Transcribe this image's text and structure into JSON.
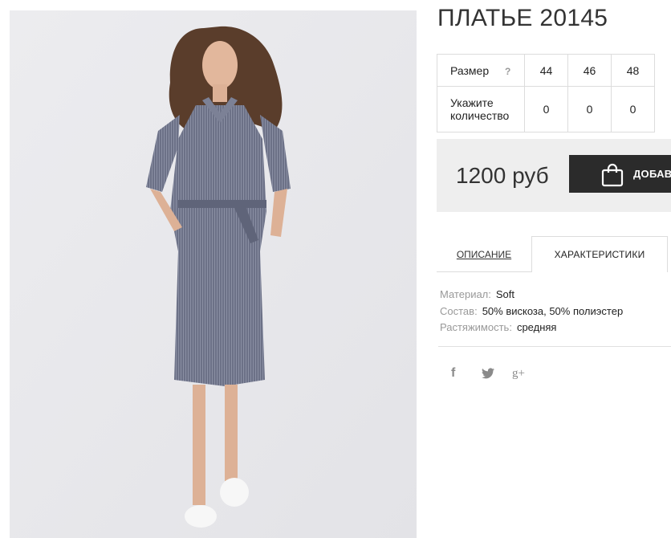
{
  "product": {
    "title": "ПЛАТЬЕ 20145",
    "image_alt": "model-wearing-dress"
  },
  "sizes": {
    "size_label": "Размер",
    "help": "?",
    "quantity_label_line1": "Укажите",
    "quantity_label_line2": "количество",
    "options": [
      {
        "size": "44",
        "qty": "0"
      },
      {
        "size": "46",
        "qty": "0"
      },
      {
        "size": "48",
        "qty": "0"
      }
    ]
  },
  "purchase": {
    "price": "1200 руб",
    "add_button": "ДОБАВ"
  },
  "tabs": [
    {
      "label": "ОПИСАНИЕ",
      "active": false
    },
    {
      "label": "ХАРАКТЕРИСТИКИ",
      "active": true
    }
  ],
  "specs": [
    {
      "key": "Материал:",
      "value": "Soft"
    },
    {
      "key": "Состав:",
      "value": "50% вискоза, 50% полиэстер"
    },
    {
      "key": "Растяжимость:",
      "value": "средняя"
    }
  ],
  "share": {
    "icons": [
      "facebook-icon",
      "twitter-icon",
      "google-plus-icon"
    ],
    "facebook": "f",
    "google_plus": "g+"
  },
  "colors": {
    "dark_button": "#2b2b2b",
    "price_bg": "#eeeeee",
    "border": "#dcdcdc"
  }
}
